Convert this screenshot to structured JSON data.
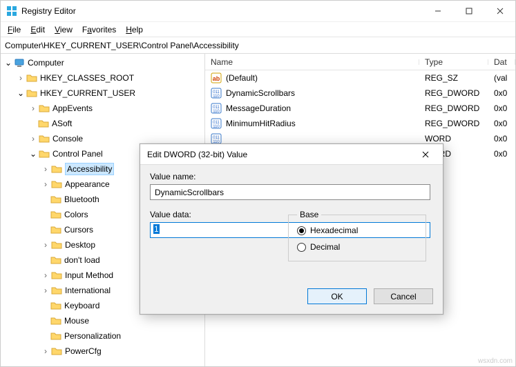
{
  "window": {
    "title": "Registry Editor"
  },
  "menu": {
    "file": "File",
    "edit": "Edit",
    "view": "View",
    "favorites": "Favorites",
    "help": "Help"
  },
  "address": "Computer\\HKEY_CURRENT_USER\\Control Panel\\Accessibility",
  "tree": {
    "root": "Computer",
    "hkcr": "HKEY_CLASSES_ROOT",
    "hkcu": "HKEY_CURRENT_USER",
    "items": {
      "appevents": "AppEvents",
      "asoft": "ASoft",
      "console": "Console",
      "controlpanel": "Control Panel",
      "sub": {
        "accessibility": "Accessibility",
        "appearance": "Appearance",
        "bluetooth": "Bluetooth",
        "colors": "Colors",
        "cursors": "Cursors",
        "desktop": "Desktop",
        "dontload": "don't load",
        "inputmethod": "Input Method",
        "international": "International",
        "keyboard": "Keyboard",
        "mouse": "Mouse",
        "personalization": "Personalization",
        "powercfg": "PowerCfg"
      }
    }
  },
  "list": {
    "headers": {
      "name": "Name",
      "type": "Type",
      "data": "Dat"
    },
    "rows": [
      {
        "name": "(Default)",
        "type": "REG_SZ",
        "data": "(val",
        "kind": "sz"
      },
      {
        "name": "DynamicScrollbars",
        "type": "REG_DWORD",
        "data": "0x0",
        "kind": "dw"
      },
      {
        "name": "MessageDuration",
        "type": "REG_DWORD",
        "data": "0x0",
        "kind": "dw"
      },
      {
        "name": "MinimumHitRadius",
        "type": "REG_DWORD",
        "data": "0x0",
        "kind": "dw"
      },
      {
        "name": "",
        "type": "WORD",
        "data": "0x0",
        "kind": "dw"
      },
      {
        "name": "",
        "type": "WORD",
        "data": "0x0",
        "kind": "dw"
      }
    ]
  },
  "dialog": {
    "title": "Edit DWORD (32-bit) Value",
    "namelabel": "Value name:",
    "namevalue": "DynamicScrollbars",
    "datalabel": "Value data:",
    "datavalue": "1",
    "baselabel": "Base",
    "hex": "Hexadecimal",
    "dec": "Decimal",
    "ok": "OK",
    "cancel": "Cancel"
  },
  "watermark": "wsxdn.com"
}
